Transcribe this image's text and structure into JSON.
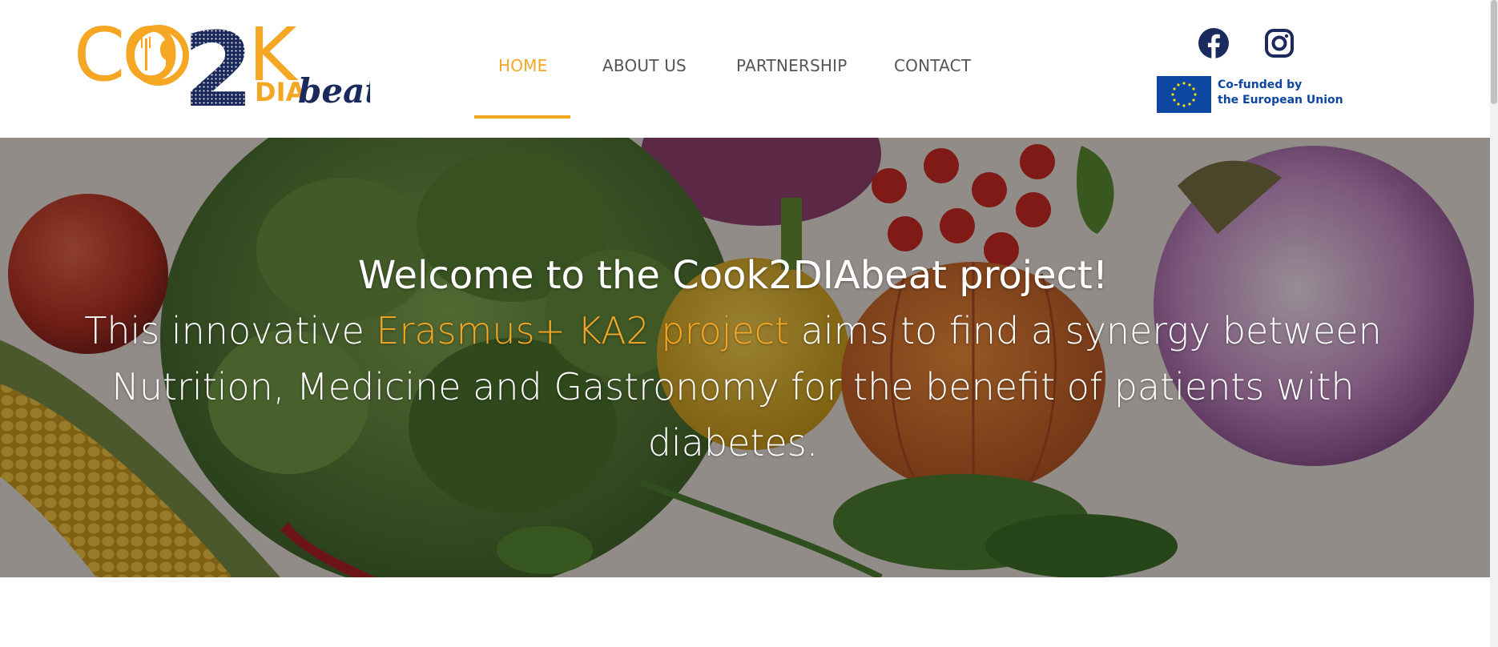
{
  "logo": {
    "alt": "Cook2DIAbeat",
    "part_co": "CO",
    "part_k": "K",
    "part_2": "2",
    "part_dia": "DIA",
    "part_beat": "beat"
  },
  "nav": {
    "items": [
      {
        "label": "HOME",
        "active": true
      },
      {
        "label": "ABOUT US",
        "active": false
      },
      {
        "label": "PARTNERSHIP",
        "active": false
      },
      {
        "label": "CONTACT",
        "active": false
      }
    ]
  },
  "social": {
    "facebook_icon": "facebook-icon",
    "instagram_icon": "instagram-icon"
  },
  "eu": {
    "line1": "Co-funded by",
    "line2": "the European Union"
  },
  "hero": {
    "title": "Welcome to the Cook2DIAbeat project!",
    "body_pre": "This innovative ",
    "body_highlight": "Erasmus+ KA2 project",
    "body_post": " aims to find a synergy between Nutrition, Medicine and Gastronomy for the benefit of patients with diabetes."
  },
  "colors": {
    "accent": "#f5a623",
    "navy": "#1b2a5c",
    "eu_blue": "#0e47a1",
    "nav_text": "#555555"
  }
}
